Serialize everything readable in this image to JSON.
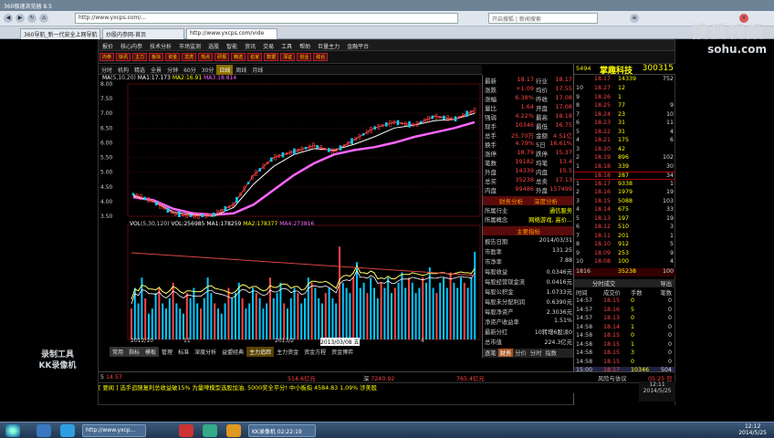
{
  "browser": {
    "title": "360极速浏览器 8.5",
    "back_icon": "back-arrow-icon",
    "forward_icon": "forward-arrow-icon",
    "url": "http://www.yxcps.com/...",
    "search_placeholder": "开启搜狐 | 新闻搜索",
    "tabs": [
      "360导航_新一代安全上网导航",
      "炒股内参网-首页",
      "http://www.yxcps.com/vide"
    ],
    "watermark": "搜狐视频",
    "watermark2": "sohu.com"
  },
  "app": {
    "menu": [
      "报价",
      "核心内参",
      "技术分析",
      "市场监测",
      "选股",
      "智能",
      "资讯",
      "交易",
      "工具",
      "帮助",
      "巨量主力",
      "金融平台"
    ],
    "toolbar": [
      "内参",
      "快讯",
      "主力",
      "板块",
      "资金",
      "龙虎",
      "热点",
      "研报",
      "精选",
      "名家",
      "数据",
      "深证",
      "创业",
      "综合"
    ],
    "chart_tabs": [
      "分时",
      "机构",
      "精选",
      "全景"
    ],
    "periods": [
      "分钟",
      "60分",
      "30分",
      "日线",
      "周线",
      "月线"
    ],
    "selected_period": "日线",
    "ma_line": {
      "label": "MA",
      "p": "(5,10,20)",
      "ma1": "MA1:17.173",
      "ma2": "MA2:16.91",
      "ma3": "MA3:18.814"
    },
    "price_axis": [
      "8.00",
      "7.50",
      "7.00",
      "6.50",
      "6.00",
      "5.50",
      "5.00",
      "4.50",
      "4.00",
      "3.50"
    ],
    "vol_line": {
      "label": "VOL",
      "p": "(5,30,120)",
      "vol": "VOL:256985",
      "ma1": "MA1:178259",
      "ma2": "MA2:178377",
      "ma4": "MA4:273816"
    },
    "date_labels": [
      "2012/10",
      "11",
      "2013/2",
      "2013/03/08 五",
      "4"
    ],
    "bottom_tabs": [
      "常用",
      "指标",
      "模板",
      "管理",
      "标准",
      "深度分析",
      "益盟经典",
      "主力追踪",
      "主力资金",
      "资金方程",
      "资金博弈"
    ],
    "quote_left": [
      {
        "k": "最新",
        "v": "18.17",
        "k2": "行业",
        "v2": "18.17"
      },
      {
        "k": "涨跌",
        "v": "+1.09",
        "k2": "均价",
        "v2": "17.55"
      },
      {
        "k": "涨幅",
        "v": "6.38%",
        "k2": "昨收",
        "v2": "17.08"
      },
      {
        "k": "量比",
        "v": "1.64",
        "k2": "开盘",
        "v2": "17.08"
      },
      {
        "k": "强弱",
        "v": "4.22%",
        "k2": "最高",
        "v2": "18.18"
      },
      {
        "k": "现手",
        "v": "10346",
        "k2": "最低",
        "v2": "16.75"
      },
      {
        "k": "总手",
        "v": "25.70万",
        "k2": "金额",
        "v2": "4.51亿"
      },
      {
        "k": "换手",
        "v": "4.79%",
        "k2": "5日",
        "v2": "16.61%"
      },
      {
        "k": "涨停",
        "v": "18.79",
        "k2": "跌停",
        "v2": "15.37"
      },
      {
        "k": "笔数",
        "v": "19182",
        "k2": "均笔",
        "v2": "13.4"
      },
      {
        "k": "外盘",
        "v": "14339",
        "k2": "内盘",
        "v2": "15.5"
      },
      {
        "k": "总买",
        "v": "35238",
        "k2": "总卖",
        "v2": "17.13"
      },
      {
        "k": "内盘",
        "v": "99486",
        "k2": "外盘",
        "v2": "157499"
      }
    ],
    "finance_header": [
      "财务分析",
      "深度分析"
    ],
    "industry": {
      "k": "所属行业",
      "v": "通信服务"
    },
    "concept": {
      "k": "所属概念",
      "v": "网络游戏, 高价..."
    },
    "main_indicators_header": "主要指标",
    "finance_rows": [
      {
        "k": "报告日期",
        "v": "2014/03/31"
      },
      {
        "k": "市盈率",
        "v": "131.25"
      },
      {
        "k": "市净率",
        "v": "7.88"
      },
      {
        "k": "每股收益",
        "v": "0.0346元"
      },
      {
        "k": "每股经营现金流",
        "v": "0.0416元"
      },
      {
        "k": "每股公积金",
        "v": "1.0733元"
      },
      {
        "k": "每股未分配利润",
        "v": "0.6390元"
      },
      {
        "k": "每股净资产",
        "v": "2.3036元"
      },
      {
        "k": "净资产收益率",
        "v": "1.51%"
      },
      {
        "k": "最新分红",
        "v": "10转增6股派0"
      },
      {
        "k": "总市值",
        "v": "224.3亿元"
      }
    ],
    "right_small_tabs": [
      "逐笔",
      "财务",
      "分价",
      "分时",
      "指数"
    ],
    "right_small_tabs2": [
      "即时",
      "交易",
      "短线",
      "资金",
      "数据"
    ],
    "stock": {
      "code_left": "5494",
      "name": "掌趣科技",
      "code": "300315"
    },
    "stock_sub": {
      "a": "18.17",
      "b": "14339",
      "c": "752"
    },
    "order_book": [
      {
        "l": "10",
        "p": "18.27",
        "q": "12",
        "d": ""
      },
      {
        "l": "9",
        "p": "18.26",
        "q": "1",
        "d": ""
      },
      {
        "l": "8",
        "p": "18.25",
        "q": "77",
        "d": "9"
      },
      {
        "l": "7",
        "p": "18.24",
        "q": "23",
        "d": "10"
      },
      {
        "l": "6",
        "p": "18.23",
        "q": "31",
        "d": "11"
      },
      {
        "l": "5",
        "p": "18.22",
        "q": "31",
        "d": "4"
      },
      {
        "l": "4",
        "p": "18.21",
        "q": "175",
        "d": "6"
      },
      {
        "l": "3",
        "p": "18.20",
        "q": "42",
        "d": ""
      },
      {
        "l": "2",
        "p": "18.19",
        "q": "896",
        "d": "102"
      },
      {
        "l": "1",
        "p": "18.18",
        "q": "339",
        "d": "30"
      },
      {
        "l": "",
        "p": "18.18",
        "q": "287",
        "d": "34"
      },
      {
        "l": "1",
        "p": "18.17",
        "q": "9338",
        "d": "1"
      },
      {
        "l": "2",
        "p": "18.16",
        "q": "1979",
        "d": "19"
      },
      {
        "l": "3",
        "p": "18.15",
        "q": "5088",
        "d": "103"
      },
      {
        "l": "4",
        "p": "18.14",
        "q": "675",
        "d": "33"
      },
      {
        "l": "5",
        "p": "18.13",
        "q": "197",
        "d": "19"
      },
      {
        "l": "6",
        "p": "18.12",
        "q": "510",
        "d": "3"
      },
      {
        "l": "7",
        "p": "18.11",
        "q": "201",
        "d": "1"
      },
      {
        "l": "8",
        "p": "18.10",
        "q": "912",
        "d": "5"
      },
      {
        "l": "9",
        "p": "18.09",
        "q": "253",
        "d": "9"
      },
      {
        "l": "10",
        "p": "18.08",
        "q": "100",
        "d": "4"
      }
    ],
    "totals": {
      "a": "1816",
      "b": "35238",
      "c": "100"
    },
    "ticks_header": "分时成交",
    "ticks_export": "导出",
    "ticks_cols": [
      "时间",
      "成交价",
      "手数",
      "笔数"
    ],
    "ticks": [
      {
        "t": "14:57",
        "p": "18.15",
        "v": "0",
        "c": "0"
      },
      {
        "t": "14:57",
        "p": "18.16",
        "v": "5",
        "c": "0"
      },
      {
        "t": "14:57",
        "p": "18.13",
        "v": "0",
        "c": "0"
      },
      {
        "t": "14:58",
        "p": "18.14",
        "v": "1",
        "c": "0"
      },
      {
        "t": "14:58",
        "p": "18.15",
        "v": "0",
        "c": "0"
      },
      {
        "t": "14:58",
        "p": "18.15",
        "v": "1",
        "c": "0"
      },
      {
        "t": "14:58",
        "p": "18.15",
        "v": "3",
        "c": "0"
      },
      {
        "t": "14:58",
        "p": "18.15",
        "v": "0",
        "c": "0"
      },
      {
        "t": "15:00",
        "p": "18.17",
        "v": "10346",
        "c": "504"
      }
    ],
    "ticker": [
      {
        "n": "5",
        "v": "14.57"
      },
      {
        "n": "",
        "v": "514.6亿元"
      },
      {
        "n": "深",
        "v": "7240.92"
      },
      {
        "n": "",
        "v": "765.4亿元"
      },
      {
        "n": "",
        "v": "风险与协议"
      },
      {
        "n": "",
        "v": "05:25 日"
      }
    ],
    "news": "[ 要闻 ] 选手追随复利总收益破15%    为量啤模型选股加油, 5000奖全平分!    中小板指 4584.83    1,09%  涉美股"
  },
  "overlay": {
    "rec1": "录制工具",
    "rec2": "KK录像机"
  },
  "clock": {
    "time": "12:11",
    "date": "2014/5/25"
  },
  "taskbar": {
    "windows": [
      "http://www.yxcp...",
      "KK录像机 02:22:19"
    ],
    "tray_time": "12:12",
    "tray_date": "2014/5/25"
  },
  "chart_data": [
    {
      "type": "line",
      "title": "",
      "ylabel": "",
      "ylim": [
        3.5,
        8.0
      ],
      "x": [
        "2012/10",
        "11",
        "2013/2",
        "2013/03/08",
        "4"
      ],
      "series": [
        {
          "name": "MA3",
          "values": [
            4.15,
            4.05,
            3.75,
            3.6,
            3.55,
            3.6,
            3.9,
            4.4,
            4.9,
            5.3,
            5.6,
            5.75,
            5.85,
            6.0,
            6.2,
            6.35,
            6.5,
            6.7
          ]
        },
        {
          "name": "MA1",
          "values": [
            4.2,
            4.0,
            3.65,
            3.55,
            3.5,
            3.8,
            4.6,
            5.2,
            5.6,
            5.8,
            5.75,
            5.95,
            6.2,
            6.5,
            6.6,
            6.75,
            6.8,
            7.0
          ]
        },
        {
          "name": "close",
          "values": [
            4.25,
            4.0,
            3.6,
            3.5,
            3.55,
            3.9,
            4.9,
            5.5,
            5.7,
            5.9,
            5.7,
            6.1,
            6.5,
            6.7,
            6.6,
            6.9,
            6.8,
            7.1
          ]
        }
      ]
    },
    {
      "type": "bar",
      "title": "",
      "ylabel": "",
      "series": [
        {
          "name": "VOL",
          "values": [
            0.3,
            0.5,
            0.35,
            0.6,
            0.4,
            0.25,
            0.3,
            0.45,
            0.5,
            0.35,
            0.3,
            0.4,
            0.55,
            0.35,
            0.3,
            0.25,
            0.45,
            0.4,
            0.5,
            0.35,
            0.3,
            0.4,
            0.6,
            0.45,
            0.35,
            0.3,
            0.25,
            0.35,
            0.5,
            0.4,
            0.45,
            0.55,
            0.4,
            0.3,
            0.35,
            0.5,
            0.45,
            0.4,
            0.3,
            0.35,
            0.6,
            0.4,
            0.45,
            0.55,
            0.35,
            0.3,
            0.4,
            0.5,
            0.45,
            0.35,
            0.4,
            0.6,
            0.55,
            0.5,
            0.4,
            0.35,
            0.45,
            0.5,
            0.4,
            0.35,
            0.9,
            0.55,
            0.5,
            0.45,
            0.6,
            0.75,
            0.5,
            0.55,
            0.45,
            0.6,
            0.5,
            0.4,
            0.55,
            0.5,
            0.6,
            0.45,
            0.5,
            0.55,
            0.65,
            0.5,
            0.6,
            0.55,
            0.45,
            0.5,
            0.6,
            0.55,
            0.7,
            0.5,
            0.45,
            0.55,
            0.6,
            0.5,
            0.65,
            0.55,
            0.5,
            0.6,
            0.55,
            0.5,
            0.6,
            0.85
          ]
        }
      ]
    }
  ],
  "colors": {
    "up": "#ff4444",
    "ma_pink": "#ff66ff",
    "ma_yellow": "#ffff66",
    "ma_white": "#ffffff",
    "vol_bar": "#00c8ff",
    "accent_dark_red": "#5a0b0b"
  }
}
